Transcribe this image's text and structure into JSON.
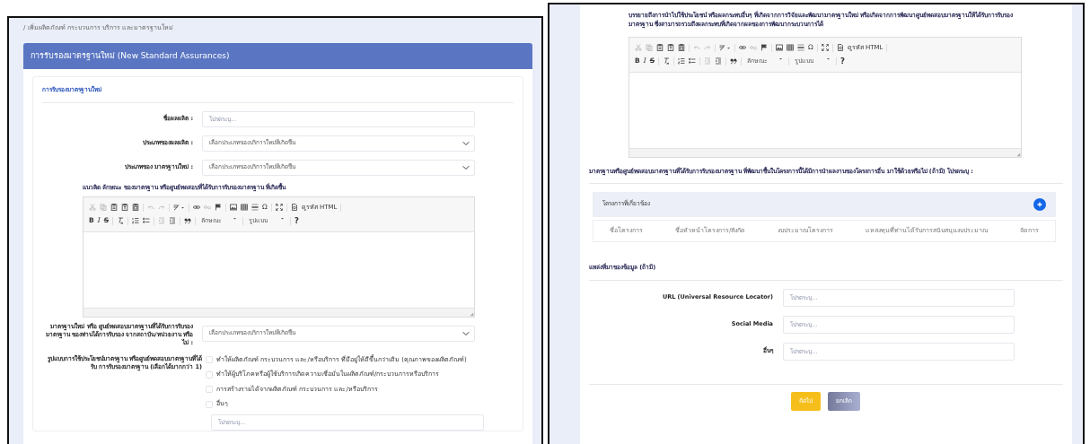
{
  "left": {
    "breadcrumb": "/ เพิ่มผลิตภัณฑ์ กระบวนการ บริการ และมาตรฐานใหม่",
    "title": "การรับรองมาตรฐานใหม่ (New Standard Assurances)",
    "section_title": "การรับรองมาตรฐานใหม่",
    "fields": [
      {
        "kind": "input",
        "label": "ชื่อผลผลิต :",
        "placeholder": "โปรดระบุ..."
      },
      {
        "kind": "select",
        "label": "ประเภทของผลผลิต :",
        "value": "เลือกประเภทของบริการใหม่ที่เกิดขึ้น"
      },
      {
        "kind": "select",
        "label": "ประเภทของ มาตรฐานใหม่ :",
        "value": "เลือกประเภทของบริการใหม่ที่เกิดขึ้น"
      }
    ],
    "editor": {
      "label": "แนวคิด ลักษณะ ของมาตรฐาน หรือศูนย์ทดสอบที่ได้รับการรับรองมาตรฐาน ที่เกิดขึ้น",
      "source": "ดูรหัส HTML",
      "bold": "B",
      "italic": "I",
      "strike": "S",
      "special_char": "Ω",
      "styles": "ลักษณะ",
      "format": "รูปแบบ",
      "help": "?"
    },
    "approval": {
      "label": "มาตรฐานใหม่ หรือ ศูนย์ทดสอบมาตรฐานที่ได้รับการรับรองมาตรฐาน ของท่านได้การรับรอง จากสถาบัน/หน่วยงาน หรือไม่ :",
      "value": "เลือกประเภทของบริการใหม่ที่เกิดขึ้น"
    },
    "usage": {
      "label": "รูปแบบการใช้ประโยชน์มาตรฐาน หรือศูนย์ทดสอบมาตรฐานที่ได้รับ การรับรองมาตรฐาน (เลือกได้มากกว่า 1)",
      "options": [
        {
          "label": "ทำให้ผลิตภัณฑ์ กระบวนการ และ/หรือบริการ ที่มีอยู่ให้ดีขึ้นกว่าเดิม (คุณภาพของผลิตภัณฑ์)",
          "checked": false
        },
        {
          "label": "ทำให้ผู้บริโภคหรือผู้ใช้บริการเกิดความเชื่อมั่นในผลิตภัณฑ์/กระบวนการหรือบริการ",
          "checked": false
        },
        {
          "label": "การสร้างรายได้จากผลิตภัณฑ์ กระบวนการ และ/หรือบริการ",
          "checked": false
        },
        {
          "label": "อื่นๆ",
          "checked": false
        }
      ],
      "other_placeholder": "โปรดระบุ..."
    }
  },
  "right": {
    "editor": {
      "label": "บรรยายถึงการนำไปใช้ประโยชน์ หรือผลกระทบอื่นๆ ที่เกิดจากการวิจัยและพัฒนามาตรฐานใหม่ หรือเกิดจากการพัฒนาศูนย์ทดสอบมาตรฐานให้ได้รับการรับรองมาตรฐาน ซึ่งสามารถรวมถึงผลกระทบที่เกิดจากผลของการพัฒนากระบวนการได้",
      "source": "ดูรหัส HTML",
      "bold": "B",
      "italic": "I",
      "strike": "S",
      "special_char": "Ω",
      "styles": "ลักษณะ",
      "format": "รูปแบบ",
      "help": "?"
    },
    "reuse_label": "มาตรฐานหรือศูนย์ทดสอบมาตรฐานที่ได้รับการรับรองมาตรฐาน ที่พัฒนาขึ้นในโครงการนี้ได้มีการนำผลงานของโครงการอื่น มาใช้ด้วยหรือไม่ (ถ้ามี) โปรดระบุ :",
    "related": {
      "title": "โครงการที่เกี่ยวข้อง",
      "columns": [
        "ชื่อโครงการ",
        "ชื่อหัวหน้าโครงการ/สังกัด",
        "งบประมาณโครงการ",
        "แหล่งทุนที่ท่านได้รับการสนับสนุนงบประมาณ",
        "จัดการ"
      ]
    },
    "sources": {
      "title": "แหล่งที่มาของข้อมูล (ถ้ามี)",
      "fields": [
        {
          "label": "URL (Universal Resource Locator)",
          "placeholder": "โปรดระบุ..."
        },
        {
          "label": "Social Media",
          "placeholder": "โปรดระบุ..."
        },
        {
          "label": "อื่นๆ",
          "placeholder": "โปรดระบุ..."
        }
      ]
    },
    "buttons": [
      {
        "label": "ถัดไป",
        "kind": "primary"
      },
      {
        "label": "ยกเลิก",
        "kind": "secondary"
      }
    ]
  }
}
